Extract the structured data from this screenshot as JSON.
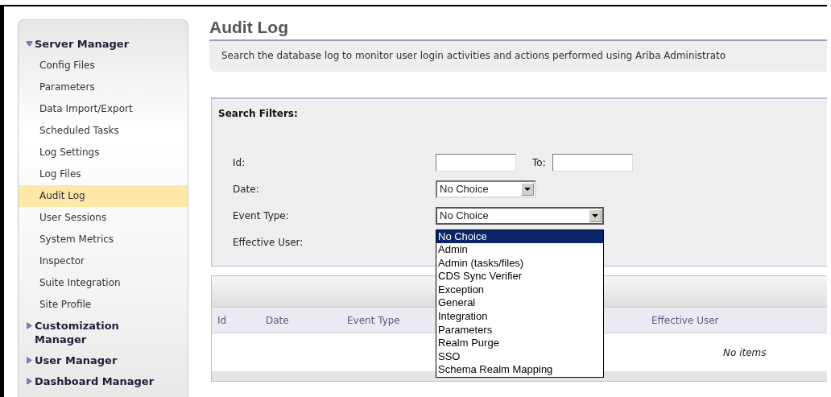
{
  "sidebar": {
    "sections": [
      {
        "label": "Server Manager",
        "expanded": true,
        "children": [
          {
            "label": "Config Files",
            "selected": false
          },
          {
            "label": "Parameters",
            "selected": false
          },
          {
            "label": "Data Import/Export",
            "selected": false
          },
          {
            "label": "Scheduled Tasks",
            "selected": false
          },
          {
            "label": "Log Settings",
            "selected": false
          },
          {
            "label": "Log Files",
            "selected": false
          },
          {
            "label": "Audit Log",
            "selected": true
          },
          {
            "label": "User Sessions",
            "selected": false
          },
          {
            "label": "System Metrics",
            "selected": false
          },
          {
            "label": "Inspector",
            "selected": false
          },
          {
            "label": "Suite Integration",
            "selected": false
          },
          {
            "label": "Site Profile",
            "selected": false
          }
        ]
      },
      {
        "label": "Customization Manager",
        "expanded": false
      },
      {
        "label": "User Manager",
        "expanded": false
      },
      {
        "label": "Dashboard Manager",
        "expanded": false
      }
    ]
  },
  "page": {
    "title": "Audit Log",
    "description": "Search the database log to monitor user login activities and actions performed using Ariba Administrato"
  },
  "search_filters": {
    "title": "Search Filters:",
    "id": {
      "label": "Id:",
      "to_label": "To:"
    },
    "date": {
      "label": "Date:",
      "value": "No Choice"
    },
    "event_type": {
      "label": "Event Type:",
      "value": "No Choice",
      "expanded": true,
      "options": [
        {
          "label": "No Choice",
          "selected": true
        },
        {
          "label": "Admin",
          "selected": false
        },
        {
          "label": "Admin (tasks/files)",
          "selected": false
        },
        {
          "label": "CDS Sync Verifier",
          "selected": false
        },
        {
          "label": "Exception",
          "selected": false
        },
        {
          "label": "General",
          "selected": false
        },
        {
          "label": "Integration",
          "selected": false
        },
        {
          "label": "Parameters",
          "selected": false
        },
        {
          "label": "Realm Purge",
          "selected": false
        },
        {
          "label": "SSO",
          "selected": false
        },
        {
          "label": "Schema Realm Mapping",
          "selected": false
        }
      ]
    },
    "effective_user": {
      "label": "Effective User:"
    }
  },
  "results": {
    "columns": [
      {
        "label": "Id"
      },
      {
        "label": "Date"
      },
      {
        "label": "Event Type"
      },
      {
        "label": "Effective User"
      }
    ],
    "empty_text": "No items"
  }
}
